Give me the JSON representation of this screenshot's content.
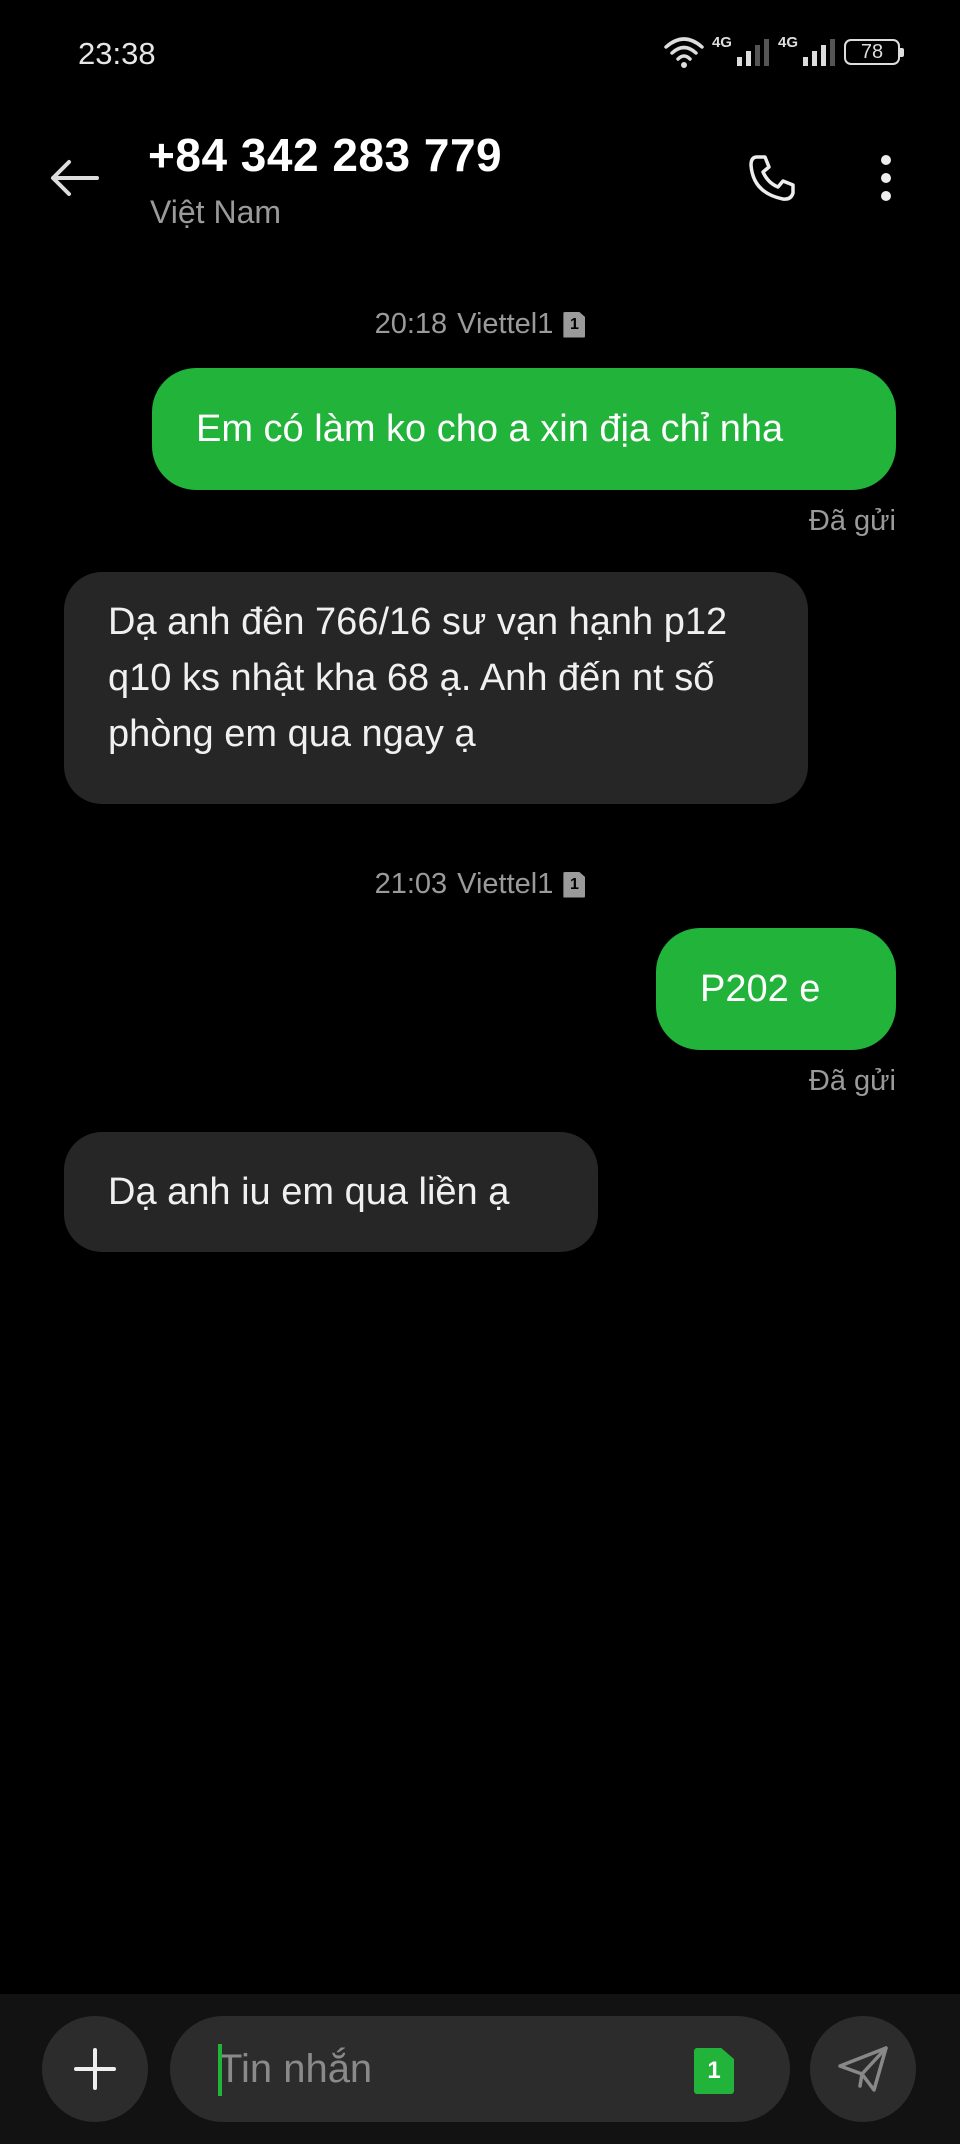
{
  "status_bar": {
    "time": "23:38",
    "network1": "4G",
    "network2": "4G",
    "battery": "78"
  },
  "header": {
    "title": "+84 342 283 779",
    "subtitle": "Việt Nam"
  },
  "messages": [
    {
      "type": "timestamp",
      "time": "20:18",
      "sim": "Viettel1",
      "sim_number": "1"
    },
    {
      "type": "outgoing",
      "text": "Em có làm ko cho a xin địa chỉ nha",
      "status": "Đã gửi"
    },
    {
      "type": "incoming",
      "text": "Dạ anh đên 766/16 sư vạn hạnh p12 q10 ks nhật kha 68 ạ. Anh đến nt số phòng em qua ngay ạ"
    },
    {
      "type": "timestamp",
      "time": "21:03",
      "sim": "Viettel1",
      "sim_number": "1"
    },
    {
      "type": "outgoing",
      "text": "P202 e",
      "status": "Đã gửi"
    },
    {
      "type": "incoming",
      "text": "Dạ anh iu em qua liền ạ"
    }
  ],
  "composer": {
    "placeholder": "Tin nhắn",
    "sim_badge": "1"
  },
  "colors": {
    "accent": "#22b33a",
    "incoming_bubble": "#262626",
    "background": "#000000"
  },
  "icons": {
    "back": "arrow-left-icon",
    "call": "phone-icon",
    "more": "more-vert-icon",
    "add": "plus-icon",
    "send": "send-icon"
  }
}
